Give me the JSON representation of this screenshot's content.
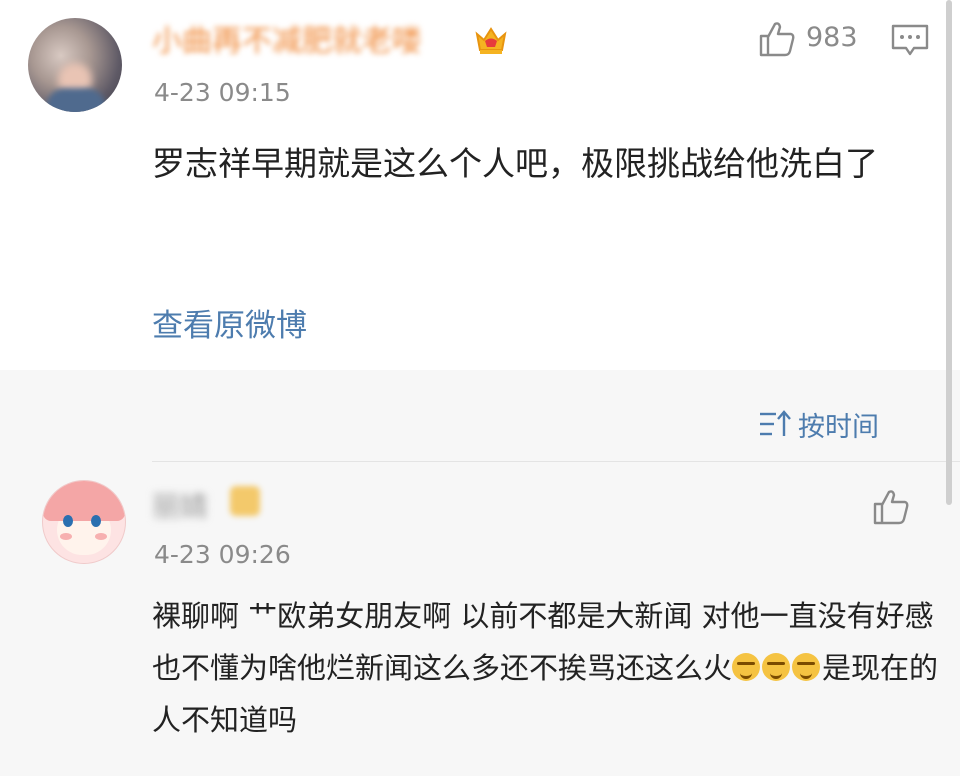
{
  "post": {
    "username": "小曲再不减肥就老喽",
    "timestamp": "4-23 09:15",
    "like_count": "983",
    "content": "罗志祥早期就是这么个人吧，极限挑战给他洗白了",
    "view_original": "查看原微博"
  },
  "sort": {
    "label": "按时间"
  },
  "reply": {
    "username": "丽婧",
    "timestamp": "4-23 09:26",
    "content_before_emoji": "裸聊啊 艹欧弟女朋友啊 以前不都是大新闻 对他一直没有好感也不懂为啥他烂新闻这么多还不挨骂还这么火",
    "content_after_emoji": "是现在的人不知道吗",
    "emoji_count": 3
  },
  "colors": {
    "link": "#4d7cae",
    "username_vip": "#f08a3a",
    "muted_text": "#8a8a8a",
    "replies_background": "#f7f7f7"
  },
  "icons": [
    "crown-icon",
    "thumbs-up-icon",
    "comment-icon",
    "sort-icon",
    "smirk-emoji-icon"
  ]
}
